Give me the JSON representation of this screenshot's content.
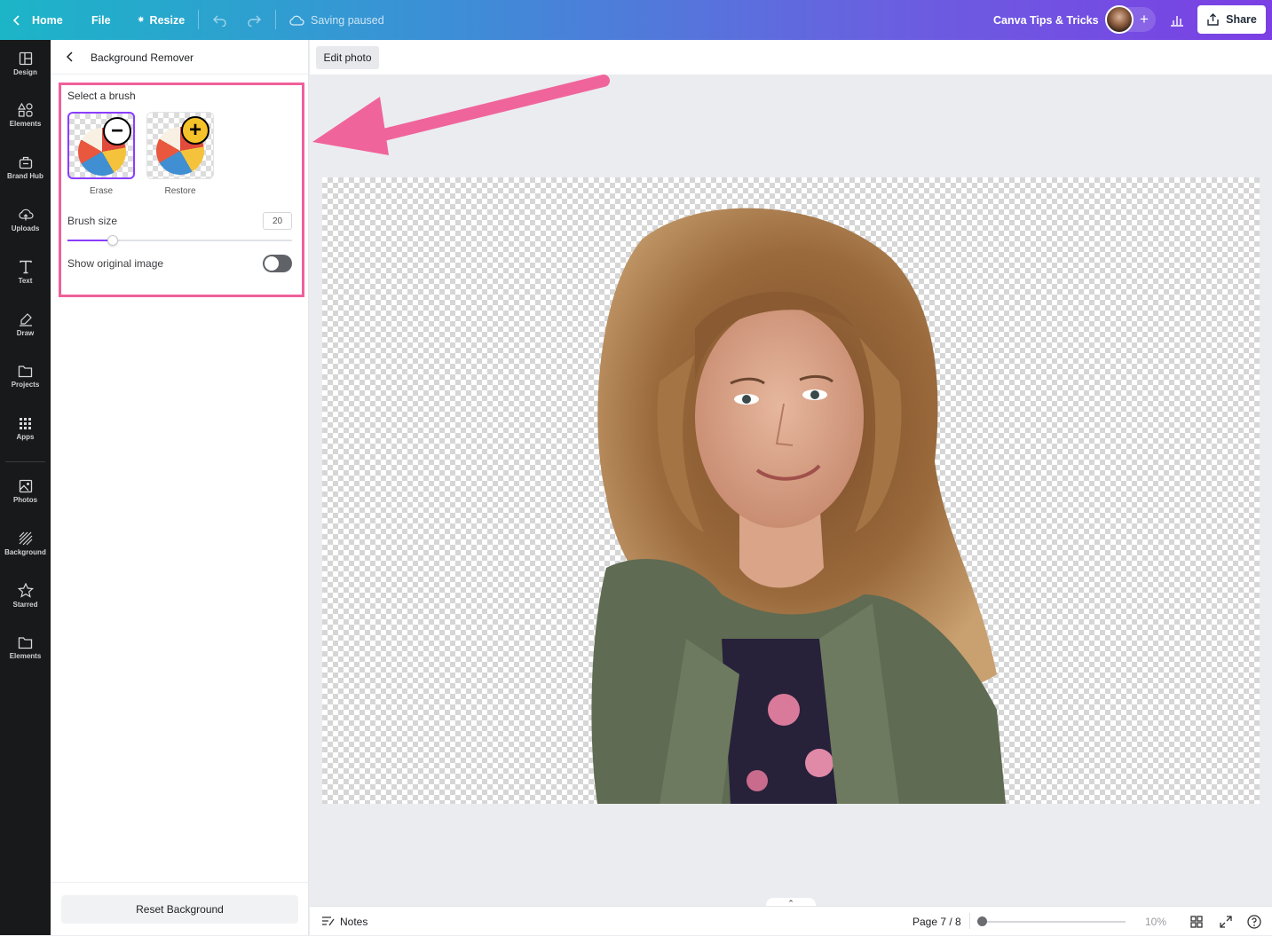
{
  "topbar": {
    "home_label": "Home",
    "file_label": "File",
    "resize_label": "Resize",
    "saving_status": "Saving paused",
    "team_name": "Canva Tips & Tricks",
    "share_label": "Share"
  },
  "leftnav": {
    "items": [
      {
        "label": "Design",
        "icon": "layout-icon"
      },
      {
        "label": "Elements",
        "icon": "shapes-icon"
      },
      {
        "label": "Brand Hub",
        "icon": "briefcase-icon"
      },
      {
        "label": "Uploads",
        "icon": "cloud-upload-icon"
      },
      {
        "label": "Text",
        "icon": "text-icon"
      },
      {
        "label": "Draw",
        "icon": "pen-icon"
      },
      {
        "label": "Projects",
        "icon": "folder-icon"
      },
      {
        "label": "Apps",
        "icon": "grid-icon"
      },
      {
        "label": "Photos",
        "icon": "image-icon"
      },
      {
        "label": "Background",
        "icon": "hatch-icon"
      },
      {
        "label": "Starred",
        "icon": "star-icon"
      },
      {
        "label": "Elements",
        "icon": "folder-icon"
      }
    ]
  },
  "panel": {
    "title": "Background Remover",
    "select_brush_title": "Select a brush",
    "brushes": [
      {
        "label": "Erase",
        "selected": true
      },
      {
        "label": "Restore",
        "selected": false
      }
    ],
    "brush_size_label": "Brush size",
    "brush_size_value": "20",
    "show_original_label": "Show original image",
    "show_original_on": false,
    "reset_label": "Reset Background"
  },
  "editor": {
    "edit_photo_label": "Edit photo"
  },
  "bottombar": {
    "notes_label": "Notes",
    "page_indicator": "Page 7 / 8",
    "zoom_label": "10%"
  },
  "colors": {
    "accent": "#8b3dff",
    "highlight": "#f0609b",
    "sidebar_bg": "#18191b"
  }
}
